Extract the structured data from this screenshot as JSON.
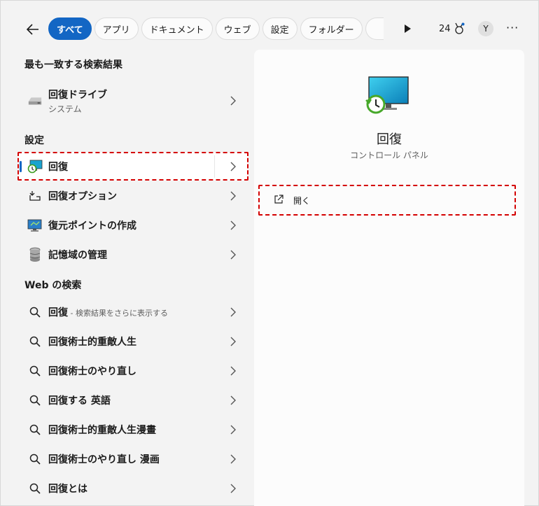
{
  "tabs": [
    "すべて",
    "アプリ",
    "ドキュメント",
    "ウェブ",
    "設定",
    "フォルダー"
  ],
  "header": {
    "points": "24",
    "avatar_letter": "Y",
    "more": "···"
  },
  "sections": {
    "best": "最も一致する検索結果",
    "settings": "設定",
    "web": "Web の検索"
  },
  "best_match": {
    "title": "回復ドライブ",
    "subtitle": "システム"
  },
  "settings_items": [
    {
      "label": "回復"
    },
    {
      "label": "回復オプション"
    },
    {
      "label": "復元ポイントの作成"
    },
    {
      "label": "記憶域の管理"
    }
  ],
  "web_items": [
    {
      "label": "回復",
      "suffix": " - 検索結果をさらに表示する"
    },
    {
      "label": "回復術士的重敵人生",
      "suffix": ""
    },
    {
      "label": "回復術士のやり直し",
      "suffix": ""
    },
    {
      "label": "回復する 英語",
      "suffix": ""
    },
    {
      "label": "回復術士的重敵人生漫畫",
      "suffix": ""
    },
    {
      "label": "回復術士のやり直し 漫画",
      "suffix": ""
    },
    {
      "label": "回復とは",
      "suffix": ""
    }
  ],
  "detail": {
    "title": "回復",
    "subtitle": "コントロール パネル",
    "open_label": "開く"
  },
  "colors": {
    "accent": "#1366c4",
    "highlight": "#d40000"
  }
}
